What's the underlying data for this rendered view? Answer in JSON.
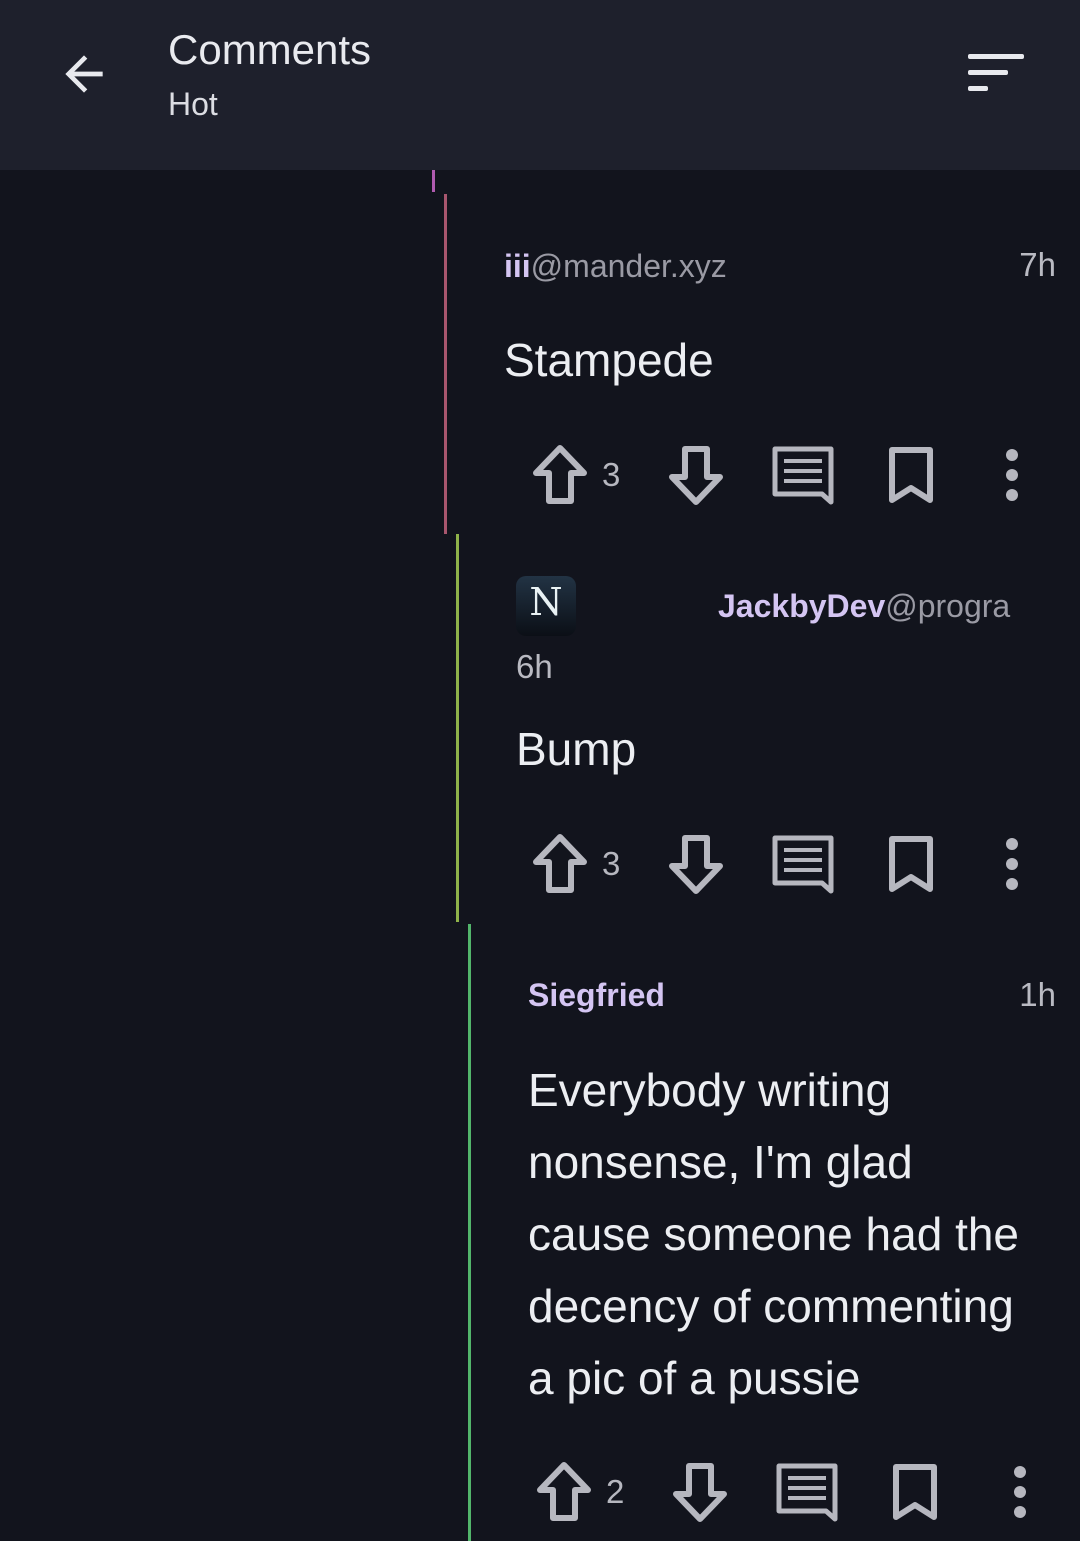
{
  "header": {
    "title": "Comments",
    "sort_label": "Hot",
    "back_icon": "arrow-left-icon",
    "sort_icon": "sort-icon"
  },
  "colors": {
    "thread_line_1": "#a8566e",
    "thread_line_2": "#8fb24a",
    "thread_line_3": "#52b56b",
    "top_tick": "#b05bb0",
    "username": "#d4c5f2"
  },
  "comments": [
    {
      "author_name": "iii",
      "author_instance": "@mander.xyz",
      "time": "7h",
      "body": "Stampede",
      "score": "3"
    },
    {
      "avatar_letter": "N",
      "author_name": "JackbyDev",
      "author_instance": "@progra",
      "time": "6h",
      "body": "Bump",
      "score": "3"
    },
    {
      "author_name": "Siegfried",
      "author_instance": "",
      "time": "1h",
      "body_lines": [
        "Everybody writing",
        "nonsense, I'm glad",
        "cause someone had the",
        "decency of commenting",
        "a pic of a pussie"
      ],
      "score": "2"
    }
  ]
}
